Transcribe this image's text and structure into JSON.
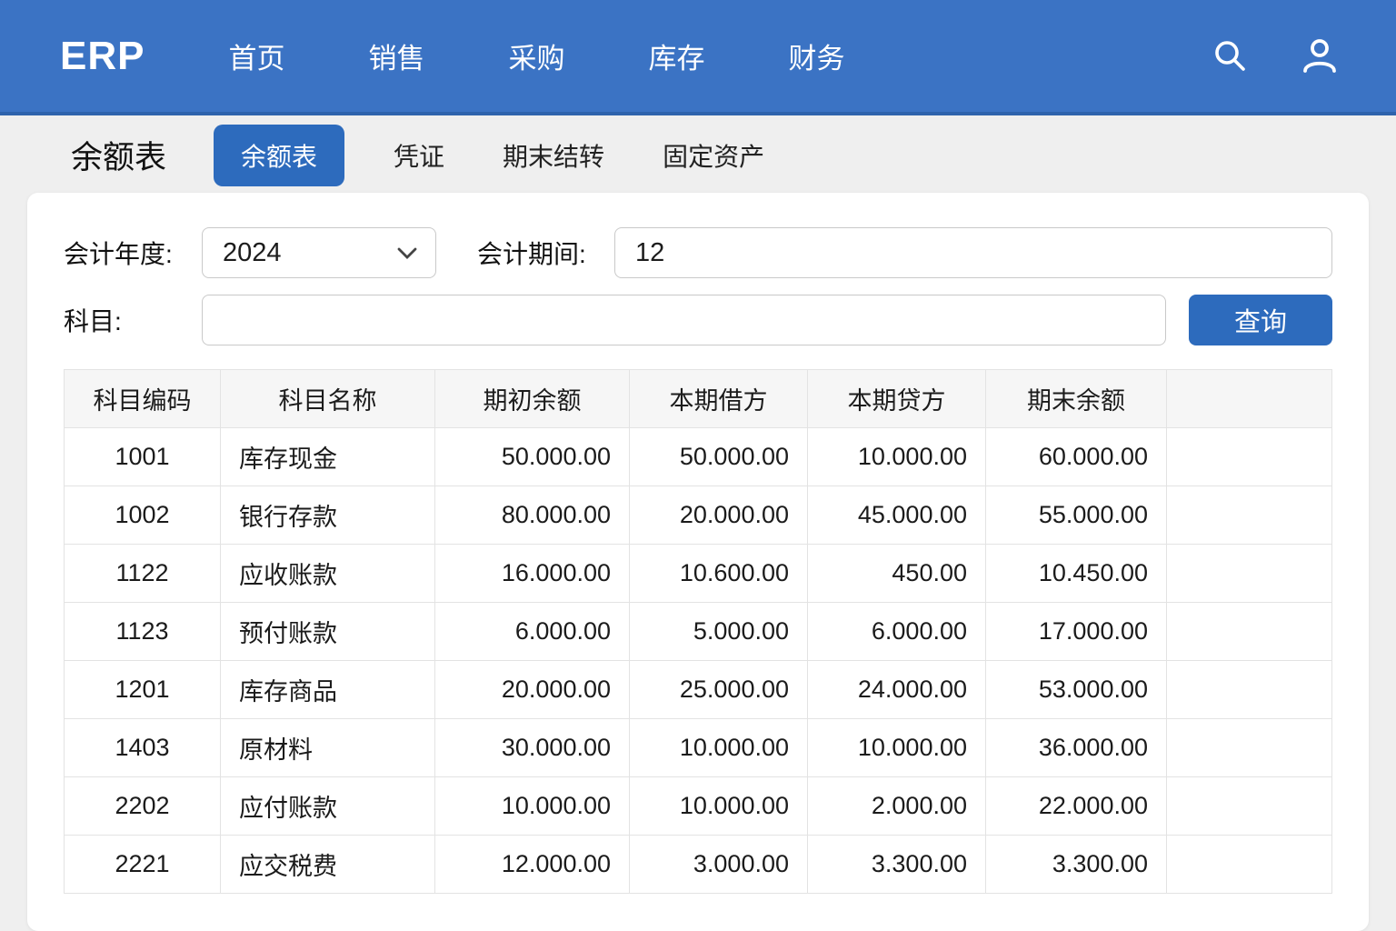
{
  "colors": {
    "nav-blue": "#3b73c4",
    "nav-blue-dark": "#2e63ac",
    "accent-blue": "#2d6bbd",
    "page-bg": "#efefef"
  },
  "nav": {
    "logo": "ERP",
    "items": [
      {
        "id": "home",
        "label": "首页"
      },
      {
        "id": "sales",
        "label": "销售"
      },
      {
        "id": "purchase",
        "label": "采购"
      },
      {
        "id": "inventory",
        "label": "库存"
      },
      {
        "id": "finance",
        "label": "财务"
      }
    ]
  },
  "page": {
    "title": "余额表",
    "tabs": [
      {
        "id": "balance",
        "label": "余额表",
        "active": true
      },
      {
        "id": "voucher",
        "label": "凭证",
        "active": false
      },
      {
        "id": "period-end",
        "label": "期末结转",
        "active": false
      },
      {
        "id": "fixed-assets",
        "label": "固定资产",
        "active": false
      }
    ]
  },
  "filters": {
    "year_label": "会计年度:",
    "year_value": "2024",
    "period_label": "会计期间:",
    "period_value": "12",
    "subject_label": "科目:",
    "subject_value": "",
    "query_button": "查询"
  },
  "table": {
    "columns": [
      "科目编码",
      "科目名称",
      "期初余额",
      "本期借方",
      "本期贷方",
      "期末余额",
      ""
    ],
    "rows": [
      [
        "1001",
        "库存现金",
        "50.000.00",
        "50.000.00",
        "10.000.00",
        "60.000.00",
        ""
      ],
      [
        "1002",
        "银行存款",
        "80.000.00",
        "20.000.00",
        "45.000.00",
        "55.000.00",
        ""
      ],
      [
        "1122",
        "应收账款",
        "16.000.00",
        "10.600.00",
        "450.00",
        "10.450.00",
        ""
      ],
      [
        "1123",
        "预付账款",
        "6.000.00",
        "5.000.00",
        "6.000.00",
        "17.000.00",
        ""
      ],
      [
        "1201",
        "库存商品",
        "20.000.00",
        "25.000.00",
        "24.000.00",
        "53.000.00",
        ""
      ],
      [
        "1403",
        "原材料",
        "30.000.00",
        "10.000.00",
        "10.000.00",
        "36.000.00",
        ""
      ],
      [
        "2202",
        "应付账款",
        "10.000.00",
        "10.000.00",
        "2.000.00",
        "22.000.00",
        ""
      ],
      [
        "2221",
        "应交税费",
        "12.000.00",
        "3.000.00",
        "3.300.00",
        "3.300.00",
        ""
      ]
    ]
  }
}
